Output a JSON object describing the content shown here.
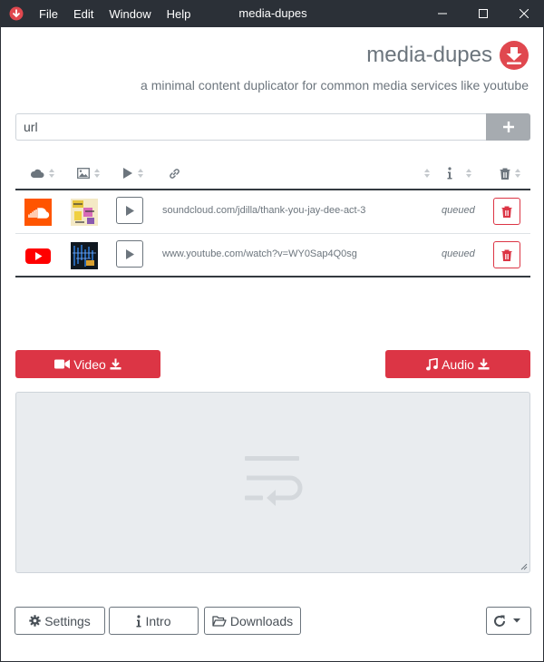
{
  "window": {
    "title": "media-dupes",
    "menu": [
      "File",
      "Edit",
      "Window",
      "Help"
    ]
  },
  "header": {
    "brand": "media-dupes",
    "tagline": "a minimal content duplicator for common media services like youtube"
  },
  "url_input": {
    "placeholder": "url"
  },
  "table": {
    "rows": [
      {
        "service": "soundcloud",
        "url": "soundcloud.com/jdilla/thank-you-jay-dee-act-3",
        "status": "queued"
      },
      {
        "service": "youtube",
        "url": "www.youtube.com/watch?v=WY0Sap4Q0sg",
        "status": "queued"
      }
    ]
  },
  "actions": {
    "video_label": "Video",
    "audio_label": "Audio"
  },
  "footer": {
    "settings_label": "Settings",
    "intro_label": "Intro",
    "downloads_label": "Downloads"
  },
  "colors": {
    "accent": "#dc3545",
    "titlebar": "#2b3037",
    "muted": "#6c757d",
    "log_bg": "#e9ecef"
  }
}
